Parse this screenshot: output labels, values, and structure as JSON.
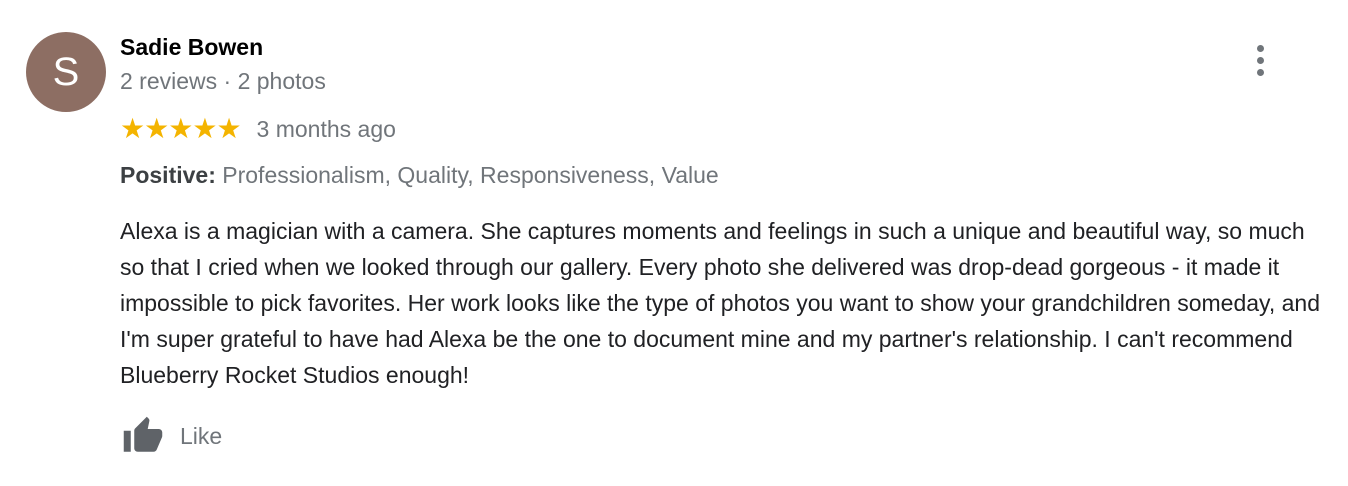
{
  "review": {
    "author": {
      "initial": "S",
      "name": "Sadie Bowen",
      "meta": "2 reviews · 2 photos",
      "avatar_color": "#8d6e63"
    },
    "rating": {
      "stars": 5,
      "max_stars": 5,
      "star_glyph": "★",
      "star_color": "#f4b400",
      "date": "3 months ago"
    },
    "highlights": {
      "label": "Positive:",
      "values": "Professionalism, Quality, Responsiveness, Value"
    },
    "text": "Alexa is a magician with a camera. She captures moments and feelings in such a unique and beautiful way, so much so that I cried when we looked through our gallery. Every photo she delivered was drop-dead gorgeous - it made it impossible to pick favorites. Her work looks like the type of photos you want to show your grandchildren someday, and I'm super grateful to have had Alexa be the one to document mine and my partner's relationship. I can't recommend Blueberry Rocket Studios enough!",
    "actions": {
      "like_label": "Like",
      "like_icon": "thumbs-up-icon",
      "more_icon": "more-vert-icon"
    }
  }
}
